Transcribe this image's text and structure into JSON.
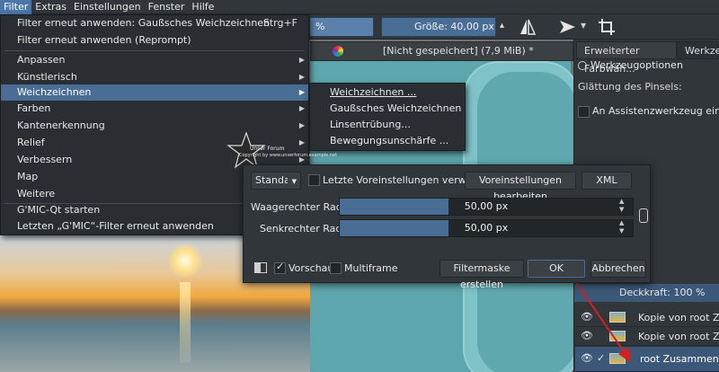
{
  "menubar": [
    "Filter",
    "Extras",
    "Einstellungen",
    "Fenster",
    "Hilfe"
  ],
  "toolbar": {
    "opacity_value": "%",
    "size_value": "Größe: 40,00 px"
  },
  "document": {
    "tab_title": "[Nicht gespeichert]  (7,9 MiB) *"
  },
  "dock": {
    "tabs": [
      "Erweiterter Farbwäh...",
      "Werkzeu"
    ],
    "panel_title": "Werkzeugoptionen",
    "smoothing_label": "Glättung des Pinsels:",
    "snap_label": "An Assistenzwerkzeug einrasten",
    "opacity_label": "Deckkraft:  100 %"
  },
  "filter_menu": {
    "items": [
      {
        "label": "Filter erneut anwenden: Gaußsches Weichzeichnen",
        "shortcut": "Strg+F"
      },
      {
        "label": "Filter erneut anwenden (Reprompt)"
      },
      {
        "label": "Anpassen"
      },
      {
        "label": "Künstlerisch"
      },
      {
        "label": "Weichzeichnen"
      },
      {
        "label": "Farben"
      },
      {
        "label": "Kantenerkennung"
      },
      {
        "label": "Relief"
      },
      {
        "label": "Verbessern"
      },
      {
        "label": "Map"
      },
      {
        "label": "Weitere"
      },
      {
        "label": "G'MIC-Qt starten"
      },
      {
        "label": "Letzten „G'MIC“-Filter erneut anwenden"
      }
    ],
    "submenu": [
      "Weichzeichnen ...",
      "Gaußsches Weichzeichnen ...",
      "Linsentrübung...",
      "Bewegungsunschärfe ..."
    ]
  },
  "dialog": {
    "preset": "Standard",
    "last_settings": "Letzte Voreinstellungen verwenden",
    "edit_presets": "Voreinstellungen bearbeiten",
    "xml": "XML",
    "h_radius_label": "Waagerechter Radius:",
    "h_radius_value": "50,00 px",
    "h_radius_fraction": 0.37,
    "v_radius_label": "Senkrechter Radius:",
    "v_radius_value": "50,00 px",
    "v_radius_fraction": 0.37,
    "preview": "Vorschau",
    "multiframe": "Multiframe",
    "filter_mask": "Filtermaske erstellen",
    "ok": "OK",
    "cancel": "Abbrechen"
  },
  "layers": [
    {
      "name": "Kopie von root Zus..."
    },
    {
      "name": "Kopie von root Zus..."
    },
    {
      "name": "root Zusammengef..."
    }
  ],
  "watermark": {
    "line1": "Unser Forum",
    "line2": "Copyright by www.unserforum.example.net"
  }
}
